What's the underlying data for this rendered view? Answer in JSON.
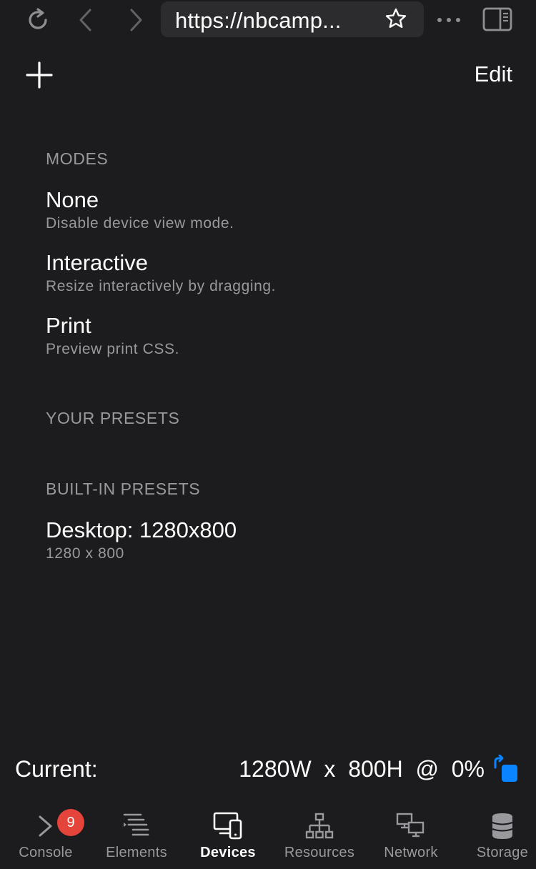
{
  "browser": {
    "url": "https://nbcamp...",
    "icons": [
      "reload-icon",
      "back-icon",
      "forward-icon",
      "star-icon",
      "more-icon",
      "sidebar-icon"
    ]
  },
  "header": {
    "add_icon": "plus-icon",
    "edit_label": "Edit"
  },
  "modes": {
    "header": "MODES",
    "items": [
      {
        "title": "None",
        "subtitle": "Disable device view mode."
      },
      {
        "title": "Interactive",
        "subtitle": "Resize interactively by dragging."
      },
      {
        "title": "Print",
        "subtitle": "Preview print CSS."
      }
    ]
  },
  "your_presets": {
    "header": "YOUR PRESETS"
  },
  "builtin_presets": {
    "header": "BUILT-IN PRESETS",
    "items": [
      {
        "title": "Desktop: 1280x800",
        "subtitle": "1280 x 800"
      }
    ]
  },
  "current": {
    "label": "Current:",
    "value": "1280W  x  800H  @  0%"
  },
  "tabs": [
    {
      "label": "Console",
      "icon": "console-icon",
      "badge": "9",
      "active": false
    },
    {
      "label": "Elements",
      "icon": "elements-icon",
      "active": false
    },
    {
      "label": "Devices",
      "icon": "devices-icon",
      "active": true
    },
    {
      "label": "Resources",
      "icon": "resources-icon",
      "active": false
    },
    {
      "label": "Network",
      "icon": "network-icon",
      "active": false
    },
    {
      "label": "Storage",
      "icon": "storage-icon",
      "active": false
    }
  ],
  "colors": {
    "background": "#1c1c1e",
    "url_bar": "#2c2c2e",
    "secondary_text": "#98989d",
    "badge": "#e5443a",
    "accent_blue": "#0a84ff"
  }
}
